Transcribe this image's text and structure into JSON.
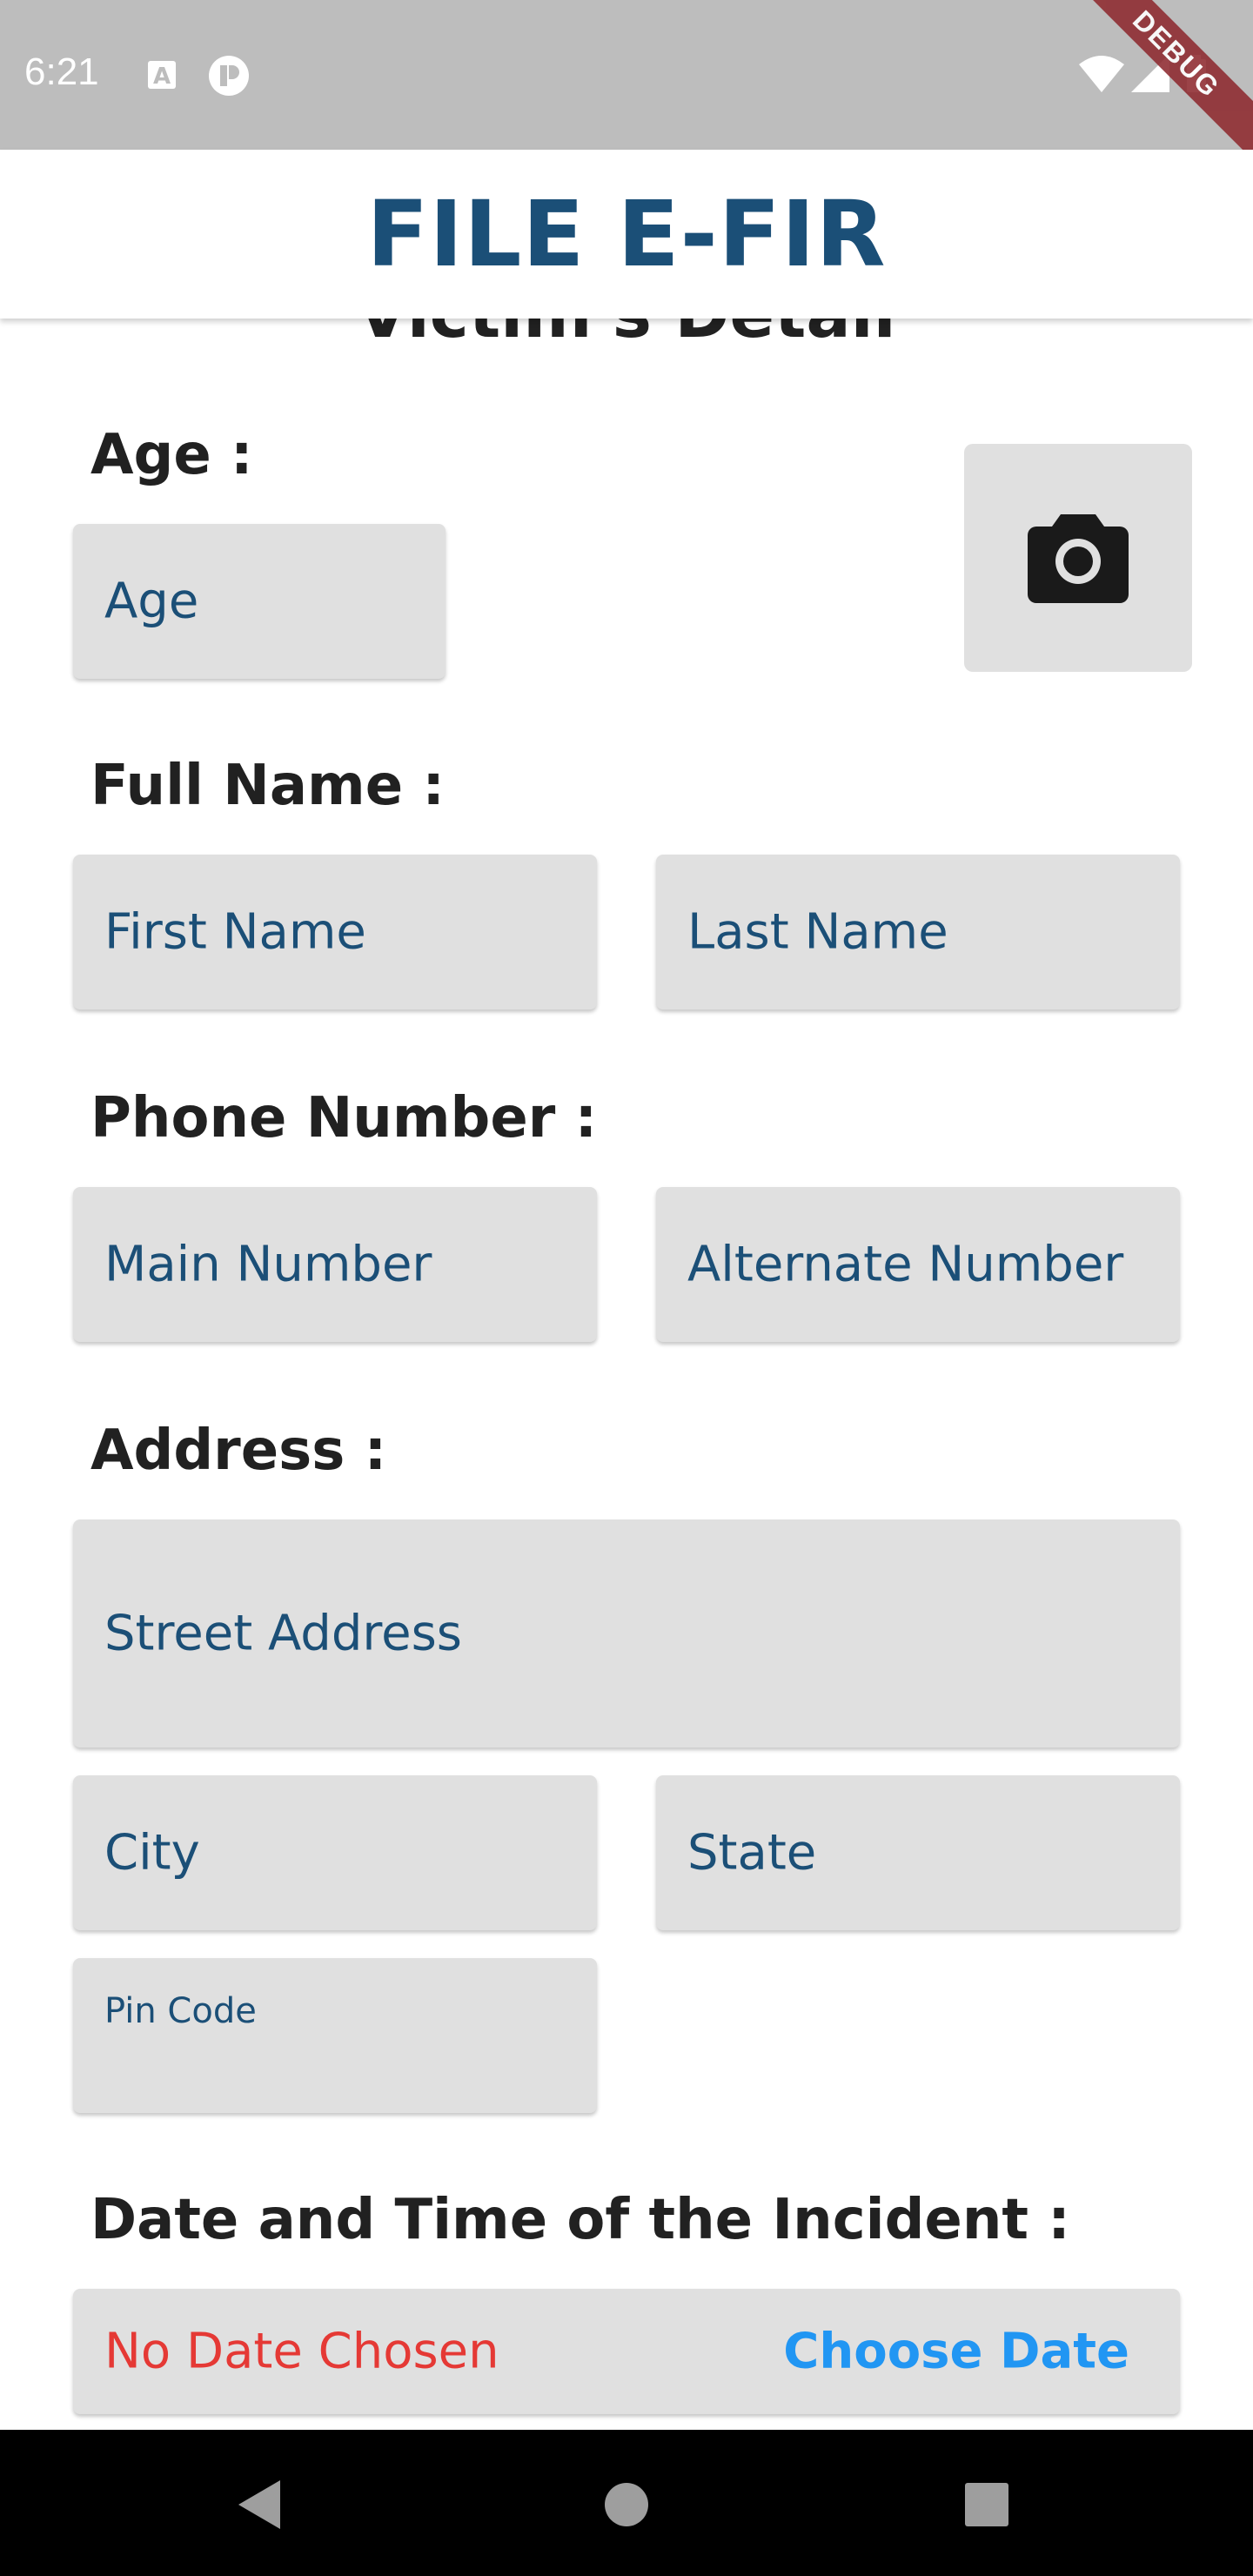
{
  "status_bar": {
    "time": "6:21"
  },
  "debug_banner": "DEBUG",
  "app_bar": {
    "title": "FILE E-FIR"
  },
  "form": {
    "section_title": "Victim's Detail",
    "age": {
      "label": "Age :",
      "placeholder": "Age"
    },
    "full_name": {
      "label": "Full Name :",
      "first_placeholder": "First Name",
      "last_placeholder": "Last Name"
    },
    "phone": {
      "label": "Phone Number :",
      "main_placeholder": "Main Number",
      "alternate_placeholder": "Alternate Number"
    },
    "address": {
      "label": "Address :",
      "street_placeholder": "Street Address",
      "city_placeholder": "City",
      "state_placeholder": "State",
      "pin_placeholder": "Pin Code"
    },
    "incident": {
      "label": "Date and Time of the Incident :",
      "date_value": "No Date Chosen",
      "choose_label": "Choose Date"
    }
  },
  "icons": {
    "camera": "camera-icon",
    "back": "back-icon",
    "home": "home-icon",
    "recents": "recents-icon"
  },
  "colors": {
    "accent": "#1b4f77",
    "error": "#e53935",
    "link": "#2196f3",
    "field_bg": "#e0e0e0"
  }
}
